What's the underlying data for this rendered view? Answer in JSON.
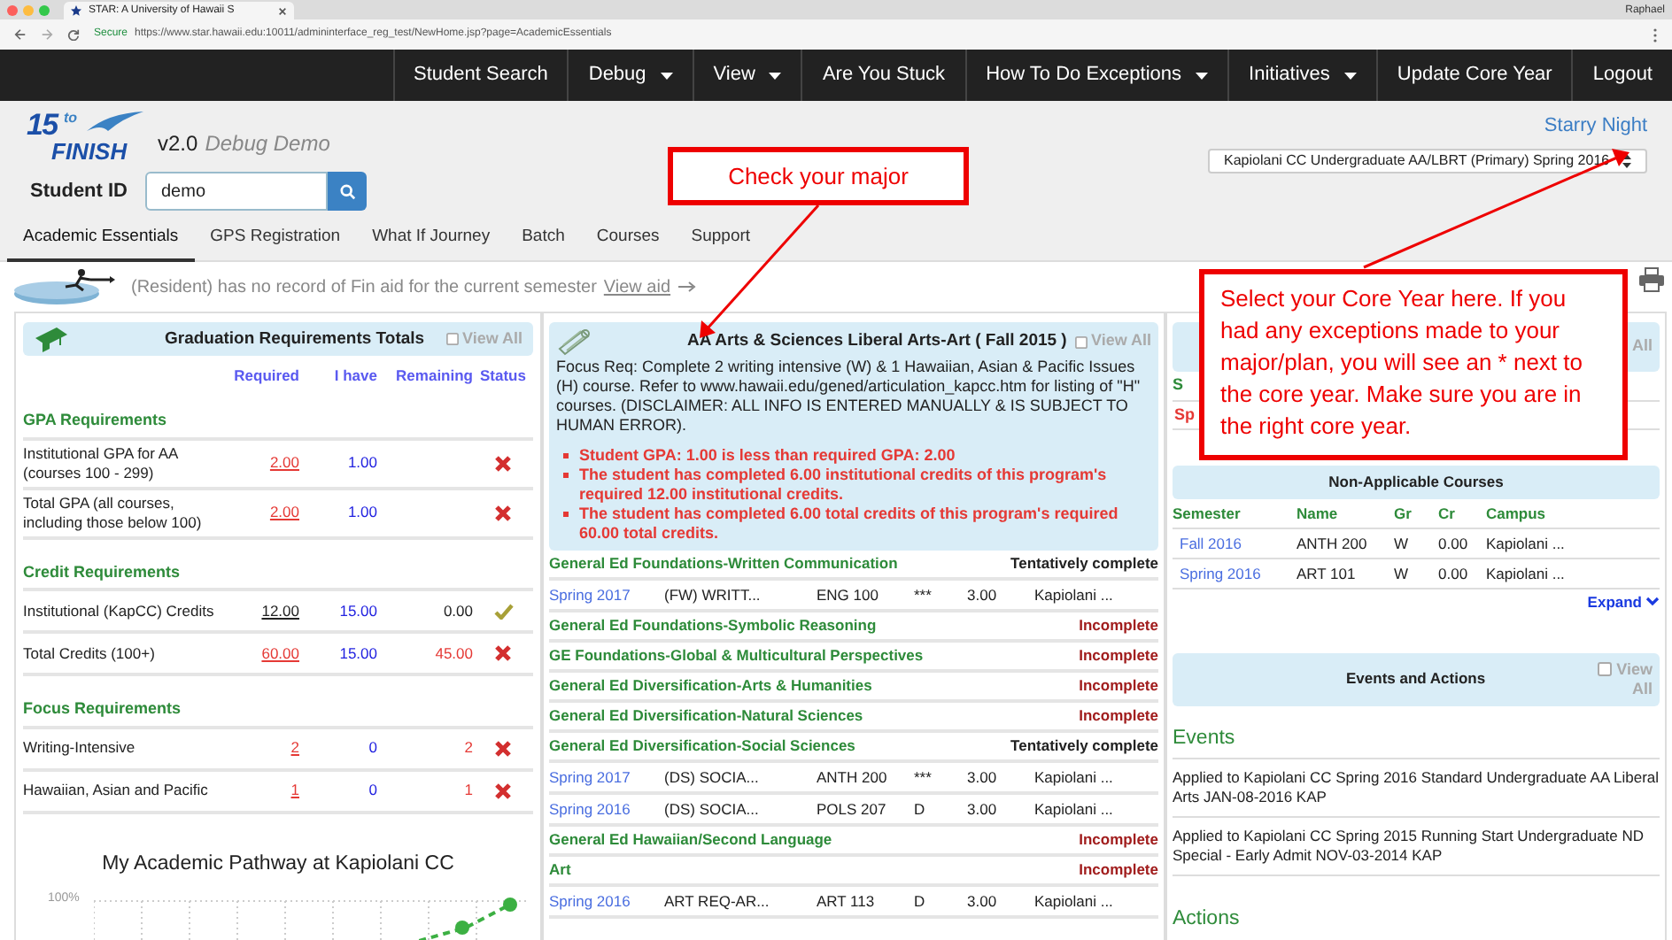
{
  "browser": {
    "tab_title": "STAR: A University of Hawaii S",
    "secure_label": "Secure",
    "url": "https://www.star.hawaii.edu:10011/admininterface_reg_test/NewHome.jsp?page=AcademicEssentials",
    "user": "Raphael"
  },
  "nav": [
    {
      "label": "Student Search",
      "dropdown": false
    },
    {
      "label": "Debug",
      "dropdown": true
    },
    {
      "label": "View",
      "dropdown": true
    },
    {
      "label": "Are You Stuck",
      "dropdown": false
    },
    {
      "label": "How To Do Exceptions",
      "dropdown": true
    },
    {
      "label": "Initiatives",
      "dropdown": true
    },
    {
      "label": "Update Core Year",
      "dropdown": false
    },
    {
      "label": "Logout",
      "dropdown": false
    }
  ],
  "header": {
    "logo": {
      "number": "15",
      "to": "to",
      "word": "FINISH"
    },
    "version": "v2.0",
    "subtitle": "Debug Demo",
    "user_name": "Starry Night",
    "core_year_select": "Kapiolani CC Undergraduate AA/LBRT (Primary) Spring 2016",
    "student_id_label": "Student ID",
    "student_id_value": "demo"
  },
  "tabs": [
    {
      "label": "Academic Essentials",
      "selected": true
    },
    {
      "label": "GPS Registration",
      "selected": false
    },
    {
      "label": "What If Journey",
      "selected": false
    },
    {
      "label": "Batch",
      "selected": false
    },
    {
      "label": "Courses",
      "selected": false
    },
    {
      "label": "Support",
      "selected": false
    }
  ],
  "fin_aid": {
    "text": "(Resident) has no record of Fin aid for the current semester",
    "link": "View aid"
  },
  "grad_totals": {
    "title": "Graduation Requirements Totals",
    "view_all": "View All",
    "view_all_checked": false,
    "columns": [
      "Required",
      "I have",
      "Remaining",
      "Status"
    ],
    "sections": [
      {
        "heading": "GPA Requirements",
        "rows": [
          {
            "label": "Institutional GPA for AA (courses 100 - 299)",
            "required": "2.00",
            "have": "1.00",
            "remaining": "",
            "kind": "fail"
          },
          {
            "label": "Total GPA (all courses, including those below 100)",
            "required": "2.00",
            "have": "1.00",
            "remaining": "",
            "kind": "fail"
          }
        ]
      },
      {
        "heading": "Credit Requirements",
        "rows": [
          {
            "label": "Institutional (KapCC) Credits",
            "required": "12.00",
            "have": "15.00",
            "remaining": "0.00",
            "kind": "pass"
          },
          {
            "label": "Total Credits (100+)",
            "required": "60.00",
            "have": "15.00",
            "remaining": "45.00",
            "kind": "fail"
          }
        ]
      },
      {
        "heading": "Focus Requirements",
        "rows": [
          {
            "label": "Writing-Intensive",
            "required": "2",
            "have": "0",
            "remaining": "2",
            "kind": "fail"
          },
          {
            "label": "Hawaiian, Asian and Pacific",
            "required": "1",
            "have": "0",
            "remaining": "1",
            "kind": "fail"
          }
        ]
      }
    ]
  },
  "pathway_chart": {
    "title": "My Academic Pathway at Kapiolani CC",
    "top_tick": "100%"
  },
  "program": {
    "title": "AA Arts & Sciences Liberal Arts-Art ( Fall 2015 )",
    "view_all": "View All",
    "view_all_checked": false,
    "focus_text": "Focus Req: Complete 2 writing intensive (W) & 1 Hawaiian, Asian & Pacific Issues (H) course. Refer to www.hawaii.edu/gened/articulation_kapcc.htm for listing of \"H\" courses. (DISCLAIMER: ALL INFO IS ENTERED MANUALLY & IS SUBJECT TO HUMAN ERROR).",
    "alerts": [
      "Student GPA: 1.00 is less than required GPA: 2.00",
      "The student has completed 6.00 institutional credits of this program's required 12.00 institutional credits.",
      "The student has completed 6.00 total credits of this program's required 60.00 total credits."
    ],
    "groups": [
      {
        "name": "General Ed Foundations-Written Communication",
        "status": "Tentatively complete",
        "kind": "tentative",
        "courses": [
          {
            "semester": "Spring 2017",
            "title": "(FW) WRITT...",
            "code": "ENG 100",
            "grade": "***",
            "credits": "3.00",
            "campus": "Kapiolani ..."
          }
        ]
      },
      {
        "name": "General Ed Foundations-Symbolic Reasoning",
        "status": "Incomplete",
        "kind": "incomplete"
      },
      {
        "name": "GE Foundations-Global & Multicultural Perspectives",
        "status": "Incomplete",
        "kind": "incomplete"
      },
      {
        "name": "General Ed Diversification-Arts & Humanities",
        "status": "Incomplete",
        "kind": "incomplete"
      },
      {
        "name": "General Ed Diversification-Natural Sciences",
        "status": "Incomplete",
        "kind": "incomplete"
      },
      {
        "name": "General Ed Diversification-Social Sciences",
        "status": "Tentatively complete",
        "kind": "tentative",
        "courses": [
          {
            "semester": "Spring 2017",
            "title": "(DS) SOCIA...",
            "code": "ANTH 200",
            "grade": "***",
            "credits": "3.00",
            "campus": "Kapiolani ..."
          },
          {
            "semester": "Spring 2016",
            "title": "(DS) SOCIA...",
            "code": "POLS 207",
            "grade": "D",
            "credits": "3.00",
            "campus": "Kapiolani ..."
          }
        ]
      },
      {
        "name": "General Ed Hawaiian/Second Language",
        "status": "Incomplete",
        "kind": "incomplete"
      },
      {
        "name": "Art",
        "status": "Incomplete",
        "kind": "incomplete",
        "courses": [
          {
            "semester": "Spring 2016",
            "title": "ART REQ-AR...",
            "code": "ART 113",
            "grade": "D",
            "credits": "3.00",
            "campus": "Kapiolani ..."
          }
        ]
      }
    ]
  },
  "hidden_panel": {
    "view_all": "All",
    "row_1": "S",
    "row_2": "Sp"
  },
  "non_applicable": {
    "title": "Non-Applicable Courses",
    "columns": [
      "Semester",
      "Name",
      "Gr",
      "Cr",
      "Campus"
    ],
    "rows": [
      {
        "semester": "Fall 2016",
        "name": "ANTH 200",
        "grade": "W",
        "credits": "0.00",
        "campus": "Kapiolani ..."
      },
      {
        "semester": "Spring 2016",
        "name": "ART 101",
        "grade": "W",
        "credits": "0.00",
        "campus": "Kapiolani ..."
      }
    ],
    "expand": "Expand"
  },
  "events_panel": {
    "title": "Events and Actions",
    "view_all": "View All",
    "view_all_checked": false,
    "events_heading": "Events",
    "events": [
      "Applied to Kapiolani CC Spring 2016 Standard Undergraduate AA Liberal Arts JAN-08-2016 KAP",
      "Applied to Kapiolani CC Spring 2015 Running Start Undergraduate ND Special - Early Admit NOV-03-2014 KAP"
    ],
    "actions_heading": "Actions"
  },
  "callouts": [
    {
      "text": "Check your major"
    },
    {
      "text": "Select your Core Year here. If you had any exceptions made to your major/plan, you will see an * next to the core year. Make sure you are in the right core year."
    }
  ]
}
